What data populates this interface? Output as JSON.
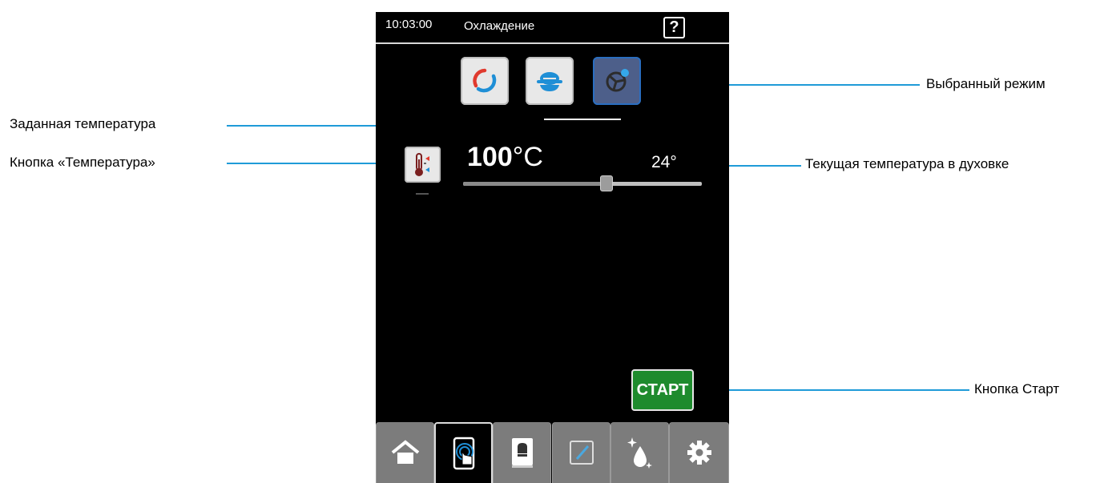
{
  "header": {
    "time": "10:03:00",
    "title": "Охлаждение",
    "help_glyph": "?"
  },
  "modes": [
    {
      "name": "convection",
      "icon": "convection-icon",
      "selected": false
    },
    {
      "name": "steam",
      "icon": "steam-dish-icon",
      "selected": false
    },
    {
      "name": "cooling",
      "icon": "fan-cooling-icon",
      "selected": true
    }
  ],
  "temperature": {
    "set_value": "100",
    "unit": "°C",
    "current": "24°",
    "slider_fraction": 0.6
  },
  "start_label": "СТАРТ",
  "tabs": [
    {
      "icon": "home-icon",
      "active": false
    },
    {
      "icon": "touch-manual-icon",
      "active": true
    },
    {
      "icon": "chef-book-icon",
      "active": false
    },
    {
      "icon": "edit-program-icon",
      "active": false
    },
    {
      "icon": "cleaning-icon",
      "active": false
    },
    {
      "icon": "settings-gear-icon",
      "active": false
    }
  ],
  "annotations": {
    "selected_mode": "Выбранный режим",
    "set_temperature": "Заданная температура",
    "temperature_button": "Кнопка «Температура»",
    "current_temperature": "Текущая температура в духовке",
    "start_button": "Кнопка Старт"
  },
  "colors": {
    "start_green": "#1e8b2d",
    "callout_blue": "#1f9bd8",
    "selected_mode": "#4d5f8a"
  }
}
